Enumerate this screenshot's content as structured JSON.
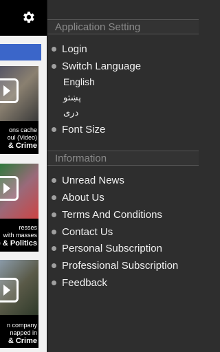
{
  "background": {
    "cards": [
      {
        "caption_1": "ons cache",
        "caption_2": "oul (Video)",
        "category": "& Crime"
      },
      {
        "caption_1": "resses",
        "caption_2": "with masses",
        "category": "e & Politics"
      },
      {
        "caption_1": "n company",
        "caption_2": "napped in",
        "category": "& Crime"
      }
    ]
  },
  "drawer": {
    "app_setting": {
      "title": "Application Setting",
      "items": [
        {
          "label": "Login"
        },
        {
          "label": "Switch Language"
        },
        {
          "label": "Font Size"
        }
      ],
      "languages": [
        "English",
        "پښتو",
        "دری"
      ]
    },
    "information": {
      "title": "Information",
      "items": [
        {
          "label": "Unread News"
        },
        {
          "label": "About Us"
        },
        {
          "label": "Terms And Conditions"
        },
        {
          "label": "Contact Us"
        },
        {
          "label": "Personal Subscription"
        },
        {
          "label": "Professional Subscription"
        },
        {
          "label": "Feedback"
        }
      ]
    }
  },
  "colors": {
    "accent": "#3b66c9",
    "drawer_bg": "#2e2e2e",
    "bullet": "#a0a0a0"
  },
  "icons": {
    "settings": "gear-icon",
    "play": "play-icon",
    "bullet": "bullet-icon"
  }
}
